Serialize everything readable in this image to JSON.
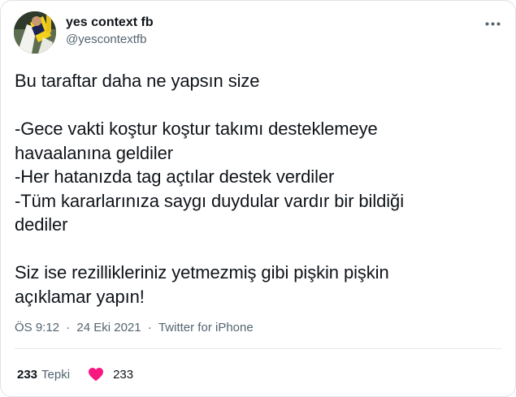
{
  "author": {
    "display_name": "yes context fb",
    "handle": "@yescontextfb"
  },
  "tweet": {
    "lines": [
      "Bu taraftar daha ne yapsın size",
      "",
      "-Gece vakti koştur koştur takımı desteklemeye",
      "havaalanına geldiler",
      "-Her hatanızda tag açtılar destek verdiler",
      "-Tüm kararlarınıza saygı duydular vardır bir bildiği",
      "dediler",
      "",
      "Siz ise rezillikleriniz yetmezmiş gibi pişkin pişkin",
      "açıklamar yapın!"
    ],
    "time": "ÖS 9:12",
    "separator": "·",
    "date": "24 Eki 2021",
    "source": "Twitter for iPhone"
  },
  "engagement": {
    "reaction_count": "233",
    "reaction_label": "Tepki",
    "like_count": "233"
  },
  "icons": {
    "more": "more-horizontal-icon",
    "like": "heart-icon"
  },
  "colors": {
    "text_primary": "#0f1419",
    "text_secondary": "#536471",
    "like": "#f91880",
    "border": "#dfe3e6"
  }
}
